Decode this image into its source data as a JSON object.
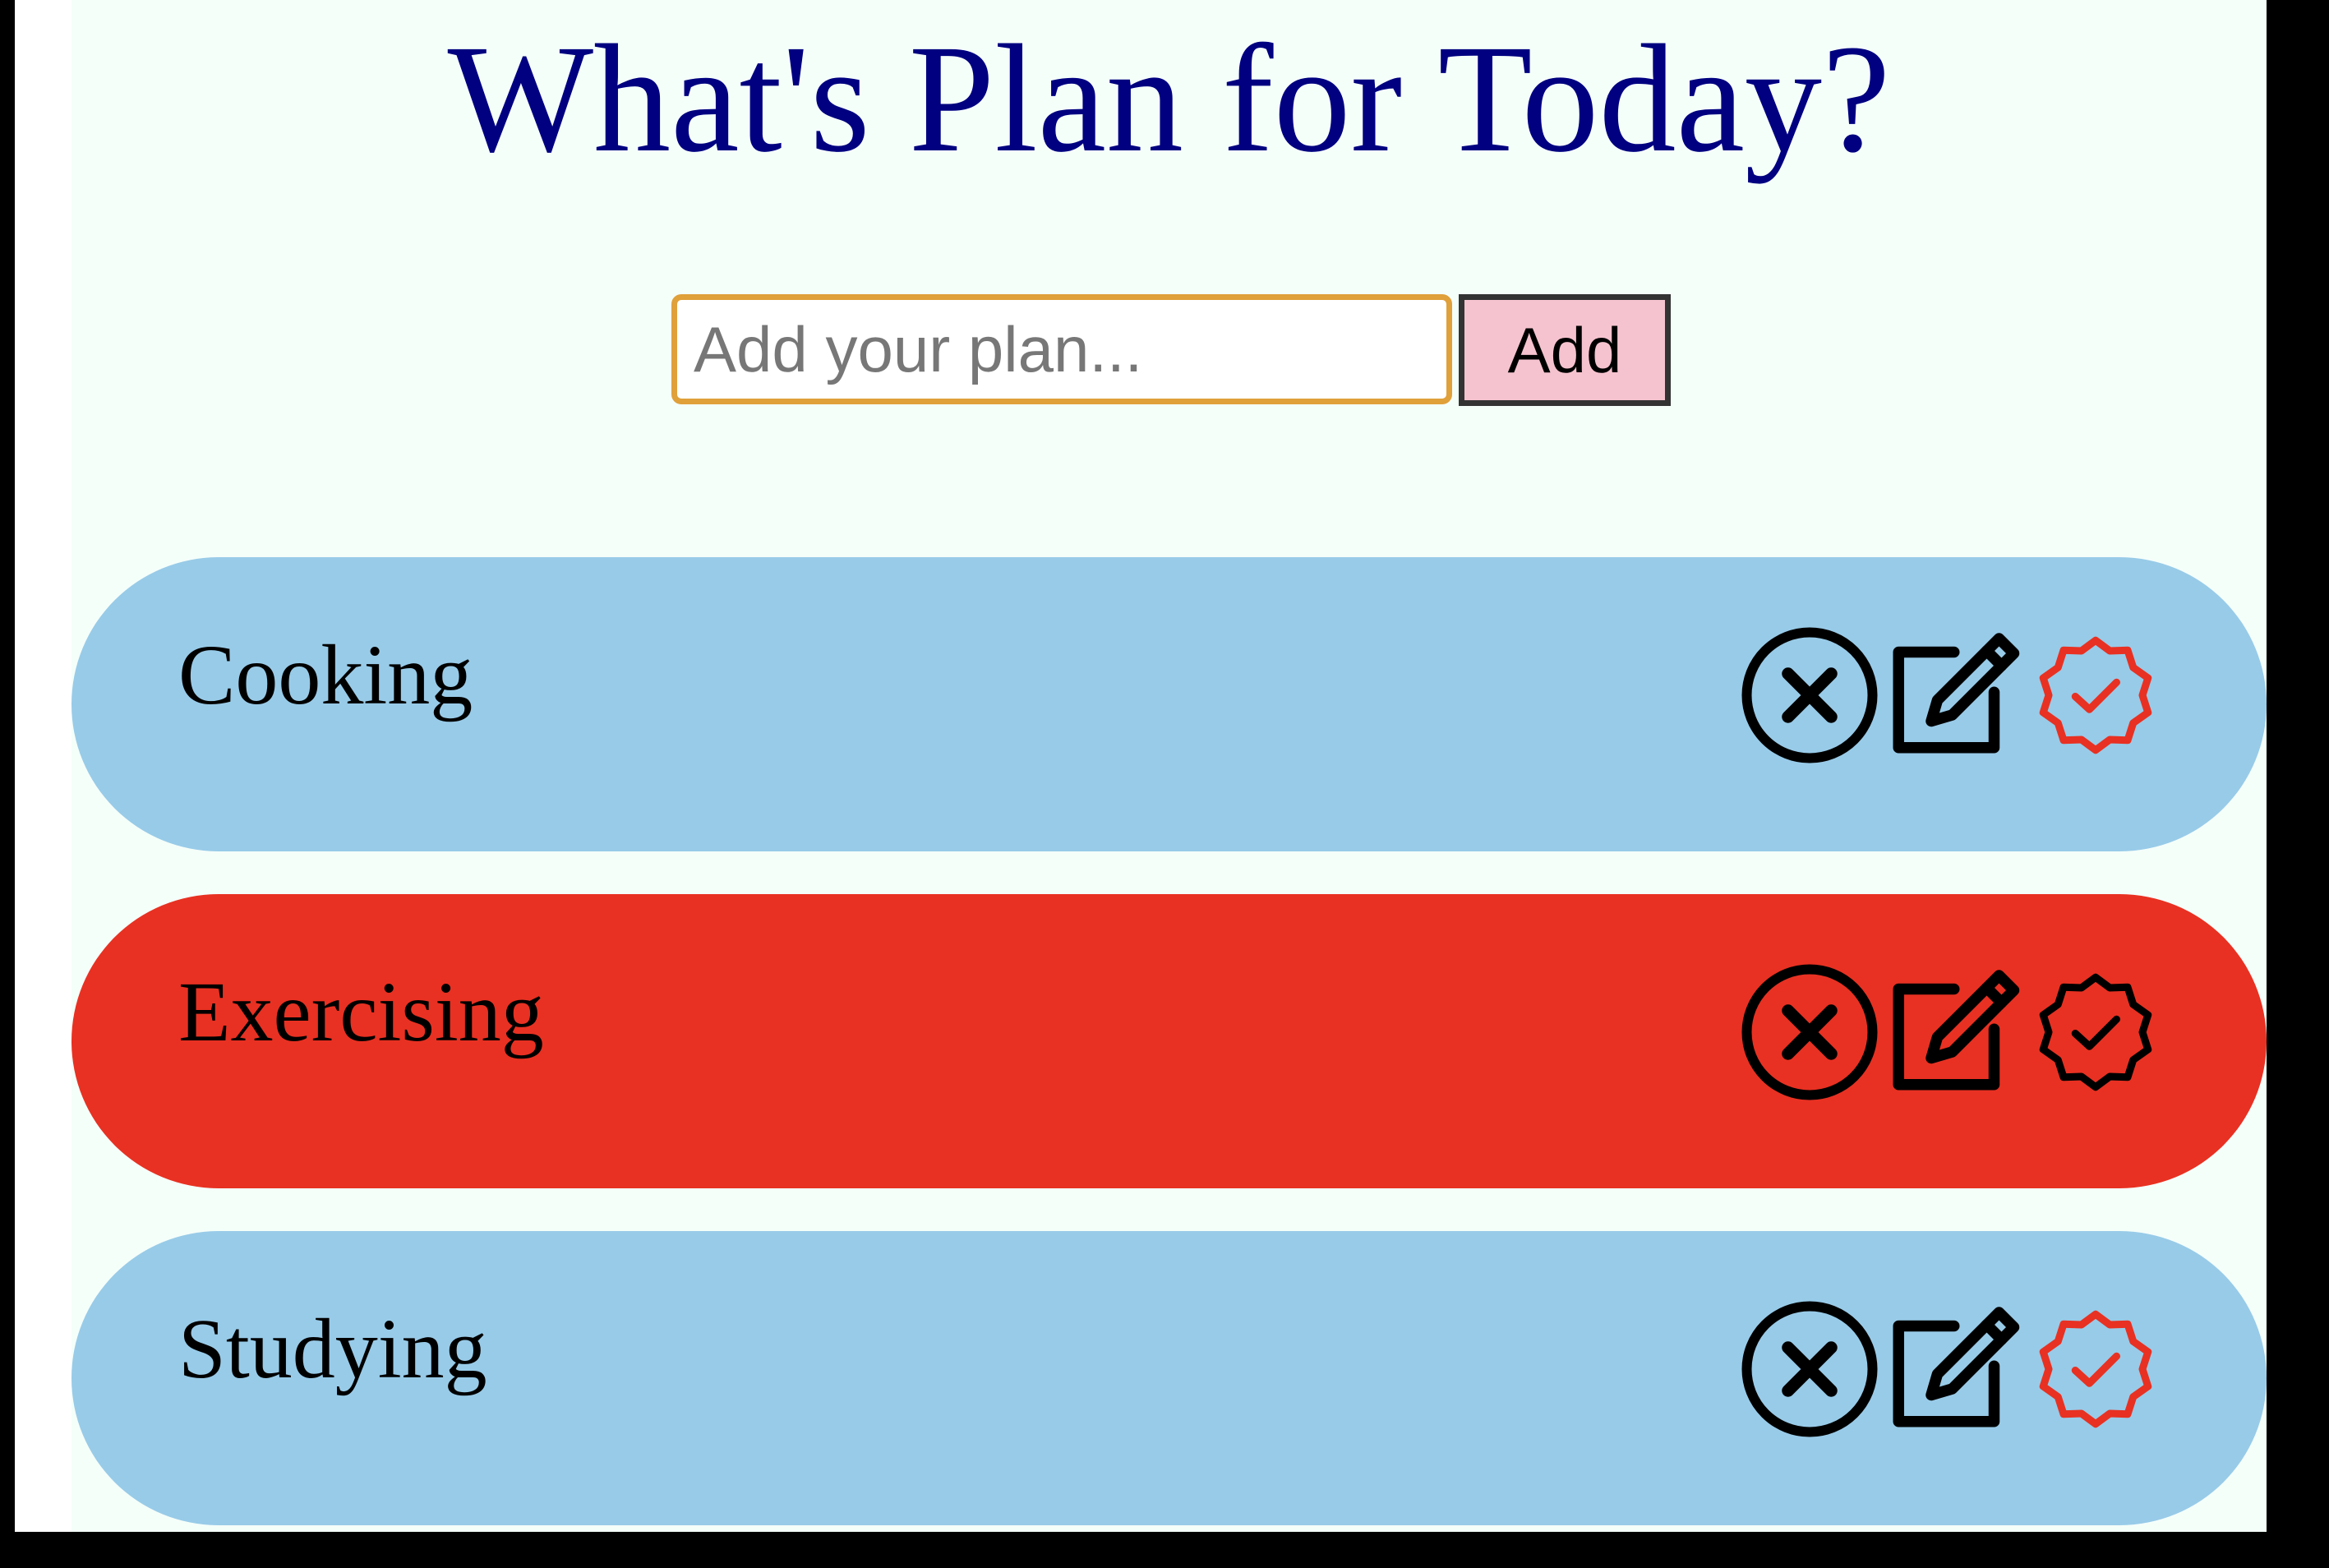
{
  "header": {
    "title": "What's Plan for Today?"
  },
  "form": {
    "input_value": "",
    "input_placeholder": "Add your plan...",
    "add_label": "Add"
  },
  "todos": [
    {
      "text": "Cooking",
      "state": "normal",
      "done_icon_color": "#e83122"
    },
    {
      "text": "Exercising",
      "state": "highlight",
      "done_icon_color": "#000000"
    },
    {
      "text": "Studying",
      "state": "normal",
      "done_icon_color": "#e83122"
    }
  ],
  "icons": {
    "delete": "x-circle-icon",
    "edit": "edit-icon",
    "done": "check-badge-icon"
  },
  "colors": {
    "title": "#000080",
    "app_background": "#f5fffa",
    "item_normal": "#98cbe8",
    "item_highlight": "#e83122",
    "add_button": "#f5c3cf",
    "input_border": "#e0a03a"
  }
}
